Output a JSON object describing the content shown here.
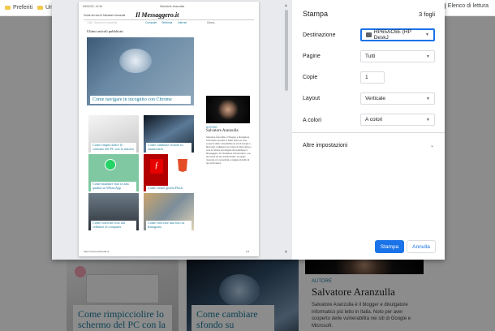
{
  "bookmarks": {
    "items": [
      {
        "label": "Preferiti"
      },
      {
        "label": "Uni"
      }
    ],
    "reading_list": "Elenco di lettura"
  },
  "background": {
    "card1_caption": "Come rimpicciolire lo schermo del PC con la tastiera",
    "card2_caption": "Come cambiare sfondo su smartwatch",
    "author_label": "AUTORE",
    "author_name": "Salvatore Aranzulla",
    "author_bio": "Salvatore Aranzulla è il blogger e divulgatore informatico più letto in Italia. Noto per aver scoperto delle vulnerabilità nei siti di Google e Microsoft."
  },
  "preview": {
    "date": "09/02/22, 11:34",
    "header_title": "Salvatore Aranzulla",
    "brand_line": "Guide del sito di Salvatore Aranzulla",
    "logo": "Il Messaggero.it",
    "nav_faded": "Tutti i Salvatore Aranzulla",
    "nav_items": [
      "Computer",
      "Telefonia",
      "Internet"
    ],
    "search": "Cerca...",
    "section_title": "Ultimi articoli pubblicati",
    "hero_caption": "Come navigare in incognito con Chrome",
    "author_label": "AUTORE",
    "author_name": "Salvatore Aranzulla",
    "author_bio": "Salvatore Aranzulla è il blogger e divulgatore informatico più letto in Italia. Noto per aver scoperto delle vulnerabilità nei siti di Google e Microsoft. Collabora con riviste di informatica e cura la rubrica tecnologica del quotidiano Il Messaggero. È il fondatore di Aranzulla.it, uno dei trenta siti più visitati d'Italia, nel quale risponde con semplicità a migliaia di dubbi di tipo informatico.",
    "thumbs": [
      {
        "caption": "Come rimpicciolire lo schermo del PC con la tastiera"
      },
      {
        "caption": "Come cambiare sfondo su smartwatch"
      },
      {
        "caption": "Come mandare foto in alta qualità su WhatsApp"
      },
      {
        "caption": "Come creare giochi Flash"
      },
      {
        "caption": "Come scaricare foto dal cellulare al computer"
      },
      {
        "caption": "Come ritoccare una foto su Instagram"
      }
    ],
    "url": "https://www.aranzulla.it/",
    "page": "1/3"
  },
  "settings": {
    "title": "Stampa",
    "sheets": "3 fogli",
    "destination_label": "Destinazione",
    "destination_value": "HP65AC6E (HP DeskJ",
    "pages_label": "Pagine",
    "pages_value": "Tutti",
    "copies_label": "Copie",
    "copies_value": "1",
    "layout_label": "Layout",
    "layout_value": "Verticale",
    "color_label": "A colori",
    "color_value": "A colori",
    "more_label": "Altre impostazioni",
    "print_label": "Stampa",
    "cancel_label": "Annulla"
  },
  "colors": {
    "accent": "#1a73e8",
    "link": "#1b7a9a"
  }
}
